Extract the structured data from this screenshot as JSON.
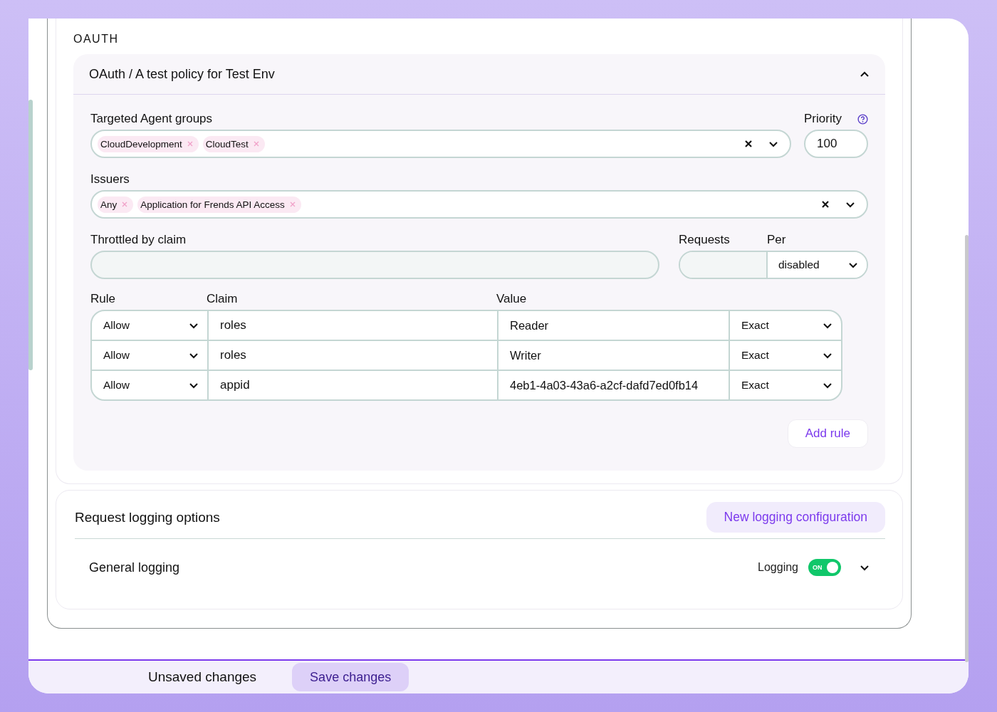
{
  "section_heading": "OAUTH",
  "policy": {
    "title": "OAuth / A test policy for Test Env",
    "expanded": true,
    "targeted_agent_groups": {
      "label": "Targeted Agent groups",
      "tags": [
        "CloudDevelopment",
        "CloudTest"
      ]
    },
    "priority": {
      "label": "Priority",
      "value": "100"
    },
    "issuers": {
      "label": "Issuers",
      "tags": [
        "Any",
        "Application for Frends API Access"
      ]
    },
    "throttled_by_claim": {
      "label": "Throttled by claim"
    },
    "requests": {
      "label": "Requests"
    },
    "per": {
      "label": "Per",
      "value": "disabled"
    },
    "rules": {
      "columns": [
        "Rule",
        "Claim",
        "Value"
      ],
      "rows": [
        {
          "rule": "Allow",
          "claim": "roles",
          "value": "Reader",
          "match": "Exact"
        },
        {
          "rule": "Allow",
          "claim": "roles",
          "value": "Writer",
          "match": "Exact"
        },
        {
          "rule": "Allow",
          "claim": "appid",
          "value": "4eb1-4a03-43a6-a2cf-dafd7ed0fb14",
          "match": "Exact"
        }
      ]
    },
    "add_rule_button": "Add rule"
  },
  "logging": {
    "title": "Request logging options",
    "new_button": "New logging configuration",
    "items": [
      {
        "name": "General logging",
        "toggle_label": "Logging",
        "on": true,
        "state_text": "ON",
        "expanded": false
      }
    ]
  },
  "footer": {
    "status": "Unsaved changes",
    "save_button": "Save changes"
  }
}
